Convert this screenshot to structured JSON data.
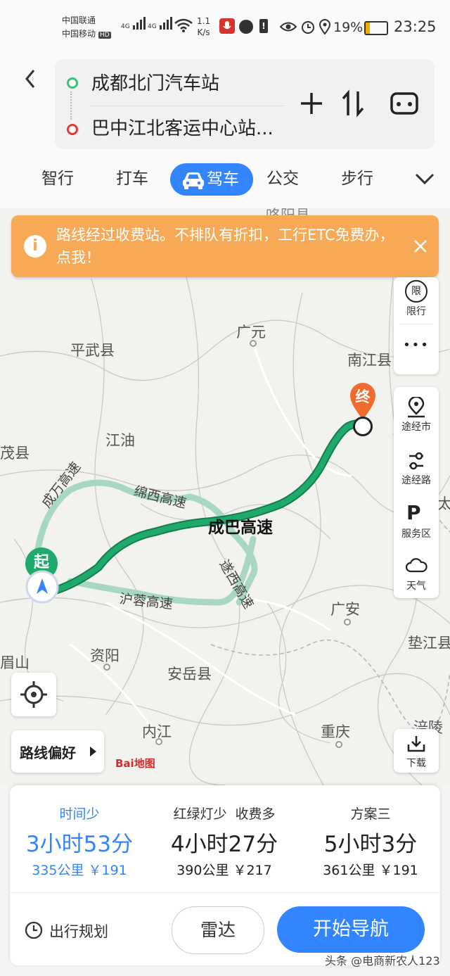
{
  "status_bar": {
    "carrier1": "中国联通",
    "carrier2": "中国移动",
    "hd": "HD",
    "net1": "4G",
    "net2": "4G",
    "speed_value": "1.1",
    "speed_unit": "K/s",
    "battery": "19%",
    "time": "23:25"
  },
  "route": {
    "start": "成都北门汽车站",
    "end": "巴中江北客运中心站..."
  },
  "tabs": [
    "智行",
    "打车",
    "驾车",
    "公交",
    "步行"
  ],
  "active_tab": "驾车",
  "banner": {
    "text": "路线经过收费站。不排队有折扣，工行ETC免费办，点我！"
  },
  "map": {
    "labels": {
      "top_cut": "咯阳县",
      "guangyuan": "广元",
      "pingwu": "平武县",
      "nanjiang": "南江县",
      "jiangyou": "江油",
      "maoxian": "茂县",
      "chengwan": "成万高速",
      "mianxi": "绵西高速",
      "chengba": "成巴高速",
      "suixi": "遂西高速",
      "hurong": "沪蓉高速",
      "guangan": "广安",
      "dianjiang": "垫江县",
      "ziyang": "资阳",
      "meishan": "眉山",
      "anyue": "安岳县",
      "neijiang": "内江",
      "chongqing": "重庆",
      "fuling": "涪陵",
      "tai": "太"
    },
    "start_marker": "起",
    "end_marker": "终",
    "logo": "Bai地图"
  },
  "side_tools": {
    "limit_icon_text": "限",
    "limit": "限行",
    "more": "•••",
    "via_city": "途经市",
    "via_road": "途经路",
    "service_icon_text": "P",
    "service": "服务区",
    "weather": "天气",
    "download": "下载"
  },
  "route_pref": "路线偏好",
  "options": [
    {
      "label": "时间少",
      "time": "3小时53分",
      "meta": "335公里 ￥191",
      "active": true
    },
    {
      "label": "红绿灯少  收费多",
      "time": "4小时27分",
      "meta": "390公里 ￥217",
      "active": false
    },
    {
      "label": "方案三",
      "time": "5小时3分",
      "meta": "361公里 ￥191",
      "active": false
    }
  ],
  "bottom": {
    "plan": "出行规划",
    "radar": "雷达",
    "navigate": "开始导航"
  },
  "watermark": "头条 @电商新农人123",
  "colors": {
    "accent": "#3385ff",
    "route": "#1faa6b",
    "alt_route": "#a8d8c2",
    "banner": "#f8a955",
    "end_marker": "#f26b2e"
  }
}
